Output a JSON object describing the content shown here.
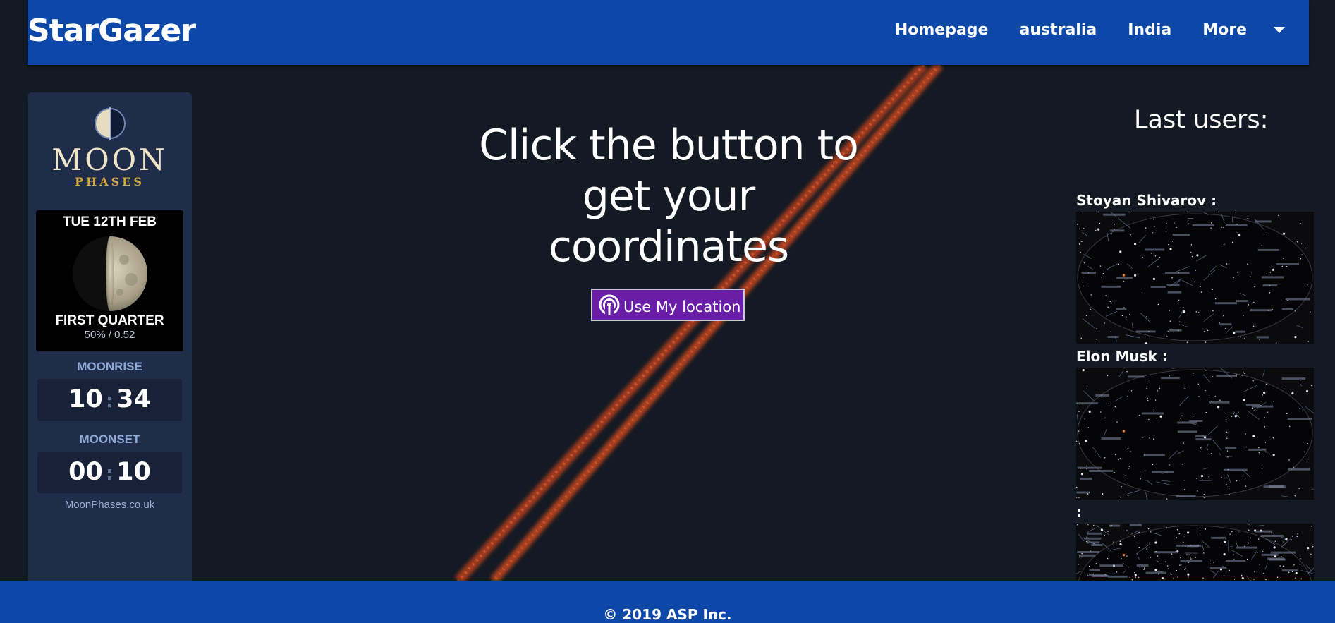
{
  "navbar": {
    "brand": "StarGazer",
    "links": [
      "Homepage",
      "australia",
      "India",
      "More"
    ]
  },
  "moon_widget": {
    "logo_word": "MOON",
    "logo_sub": "PHASES",
    "date": "TUE 12TH FEB",
    "phase_name": "FIRST QUARTER",
    "phase_pct": "50% / 0.52",
    "moonrise_label": "MOONRISE",
    "moonrise_h": "10",
    "moonrise_m": "34",
    "moonset_label": "MOONSET",
    "moonset_h": "00",
    "moonset_m": "10",
    "credit": "MoonPhases.co.uk"
  },
  "main": {
    "headline_lines": [
      "Click the button to",
      "get your",
      "coordinates"
    ],
    "button_label": "Use My location",
    "button_icon": "location-signal-icon"
  },
  "last_users": {
    "title": "Last users:",
    "users": [
      {
        "name": "Stoyan Shivarov :"
      },
      {
        "name": "Elon Musk :"
      },
      {
        "name": ":"
      }
    ]
  },
  "footer": {
    "text": "© 2019 ASP Inc."
  },
  "colors": {
    "navbar": "#0d47a8",
    "page_bg": "#141a24",
    "button": "#6a1ea8",
    "moon_panel": "#1f2d4b",
    "streak": "#c6461f"
  }
}
